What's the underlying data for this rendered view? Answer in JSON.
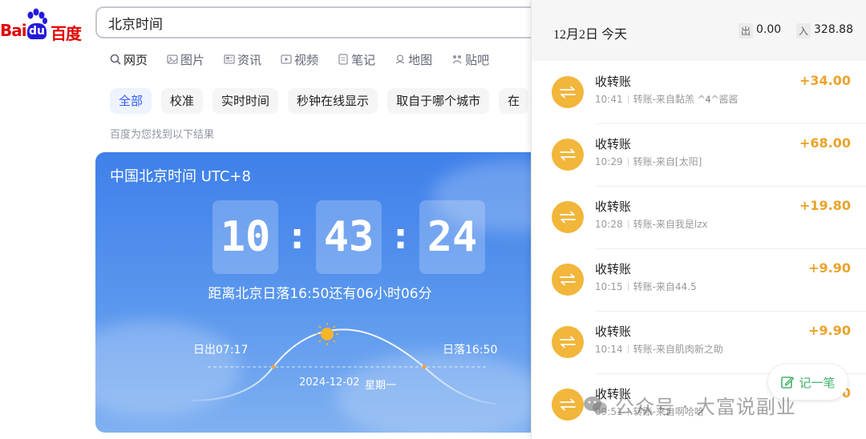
{
  "baidu": {
    "logo": {
      "bai": "Bai",
      "du": "du",
      "chinese": "百度"
    },
    "search": {
      "value": "北京时间"
    },
    "nav": [
      {
        "label": "网页",
        "icon": "search-icon"
      },
      {
        "label": "图片",
        "icon": "image-icon"
      },
      {
        "label": "资讯",
        "icon": "news-icon"
      },
      {
        "label": "视频",
        "icon": "video-icon"
      },
      {
        "label": "笔记",
        "icon": "note-icon"
      },
      {
        "label": "地图",
        "icon": "map-icon"
      },
      {
        "label": "贴吧",
        "icon": "tieba-icon"
      }
    ],
    "chips": [
      "全部",
      "校准",
      "实时时间",
      "秒钟在线显示",
      "取自于哪个城市",
      "在"
    ],
    "result_hint": "百度为您找到以下结果",
    "time_card": {
      "title": "中国北京时间 UTC+8",
      "hours": "10",
      "minutes": "43",
      "seconds": "24",
      "sunset_info": "距离北京日落16:50还有06小时06分",
      "sunrise": "日出07:17",
      "sunset": "日落16:50",
      "date": "2024-12-02",
      "weekday": "星期一"
    },
    "colors": {
      "brand_red": "#e10602",
      "brand_blue": "#2319dc",
      "accent": "#315efb"
    }
  },
  "ledger": {
    "header": {
      "date": "12月2日 今天",
      "out_label": "出",
      "out_value": "0.00",
      "in_label": "入",
      "in_value": "328.88"
    },
    "transactions": [
      {
        "title": "收转账",
        "time": "10:41",
        "desc": "转账-来自黏羔 ^𝟒^酱酱",
        "amount": "+34.00"
      },
      {
        "title": "收转账",
        "time": "10:29",
        "desc": "转账-来自[太阳]",
        "amount": "+68.00"
      },
      {
        "title": "收转账",
        "time": "10:28",
        "desc": "转账-来自我是lzx",
        "amount": "+19.80"
      },
      {
        "title": "收转账",
        "time": "10:15",
        "desc": "转账-来自44.5",
        "amount": "+9.90"
      },
      {
        "title": "收转账",
        "time": "10:14",
        "desc": "转账-来自肌肉新之助",
        "amount": "+9.90"
      },
      {
        "title": "收转账",
        "time": "09:51",
        "desc": "转账-来自啊哈哈",
        "amount": "+9.90"
      }
    ],
    "fab_label": "记一笔",
    "colors": {
      "income": "#eba32a",
      "icon_bg": "#f1b63a",
      "fab": "#45b36b"
    }
  },
  "watermark": "公众号 · 大富说副业"
}
